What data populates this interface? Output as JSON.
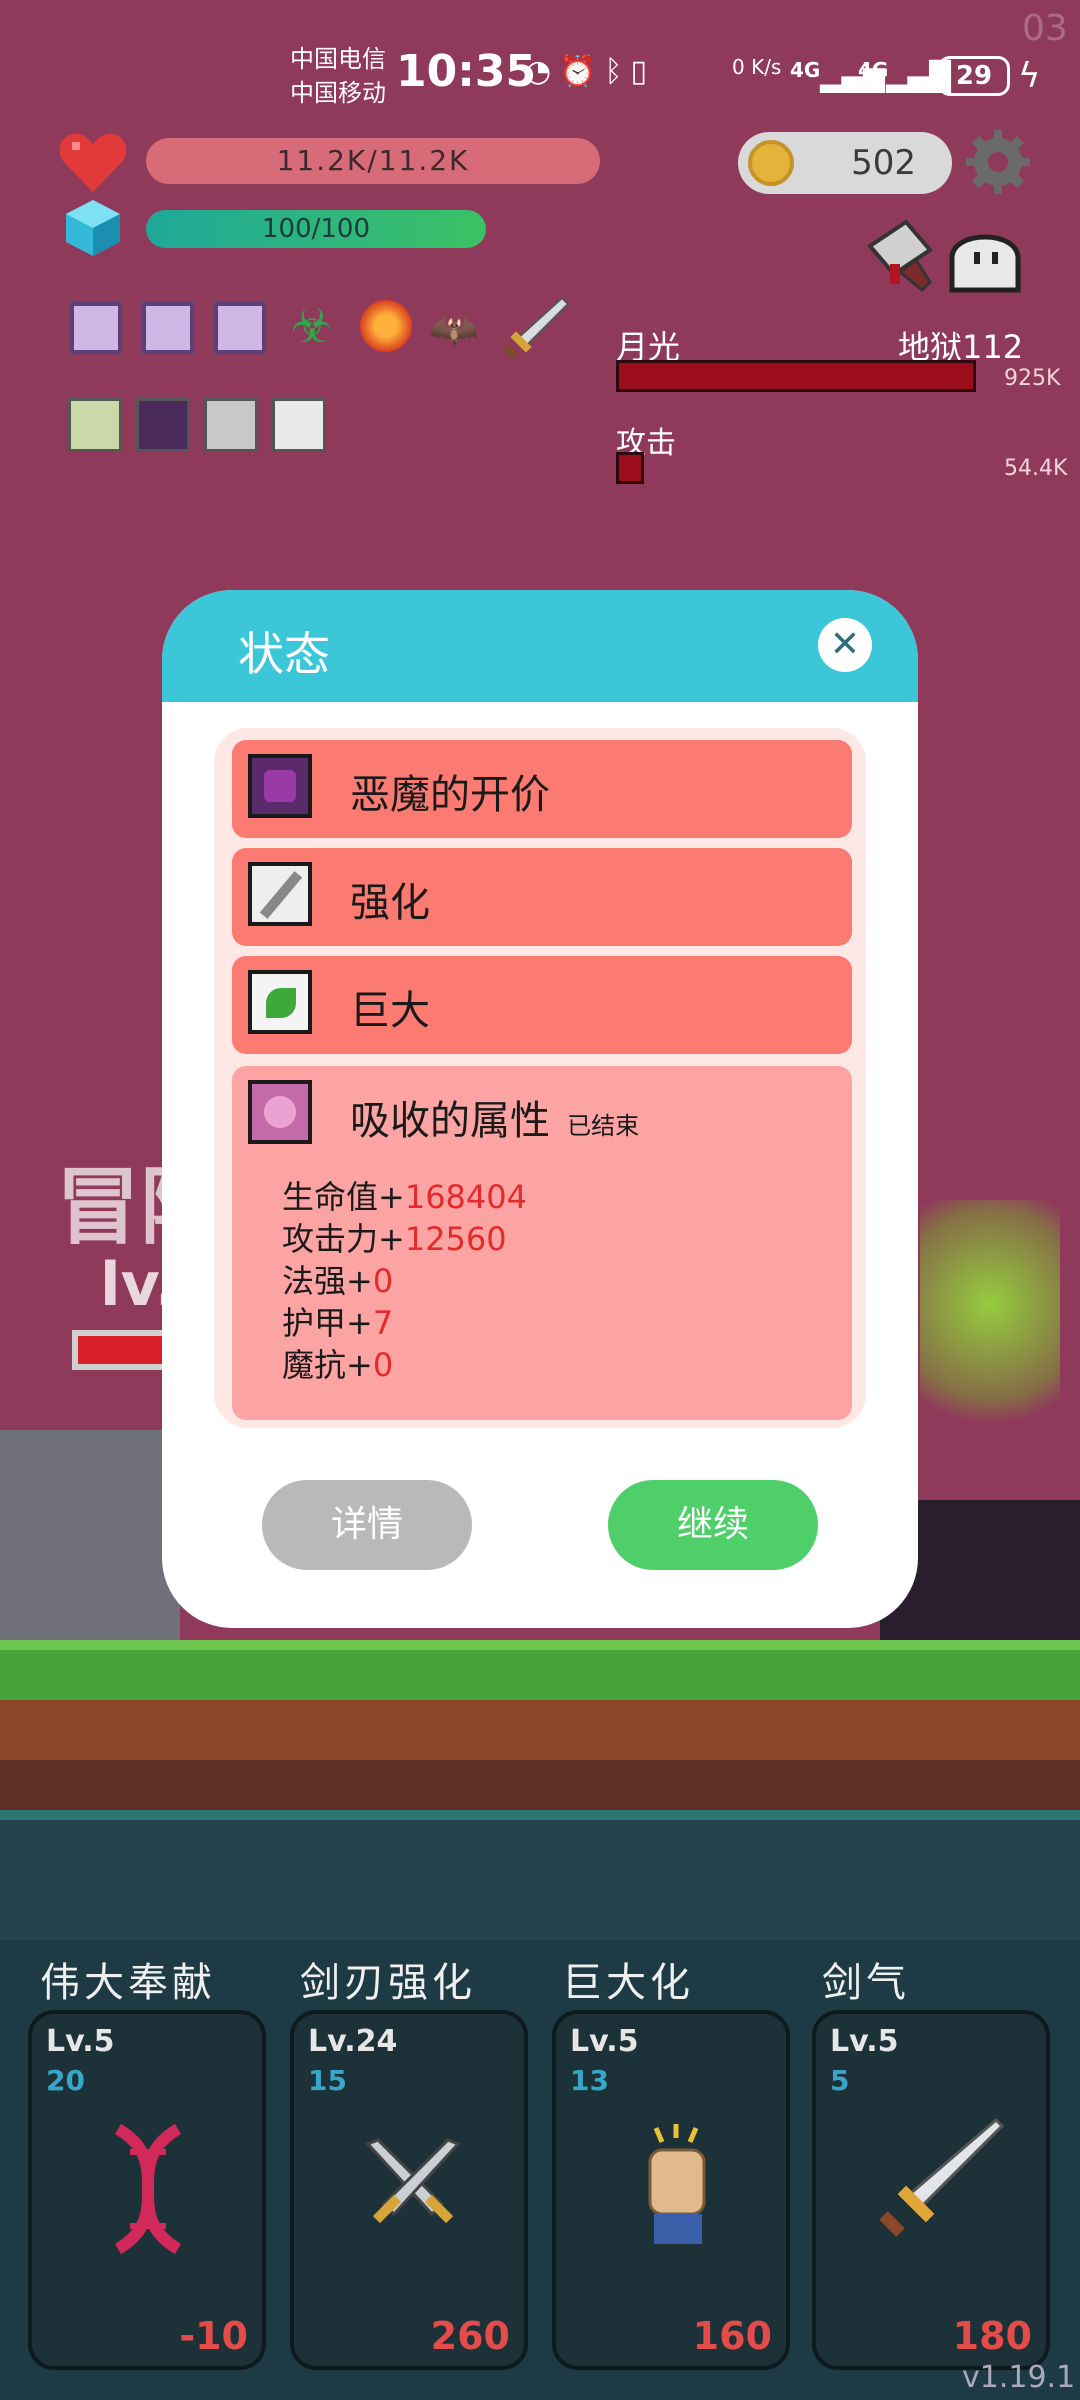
{
  "status_bar": {
    "carrier_1": "中国电信",
    "carrier_2": "中国移动",
    "time": "10:35",
    "net_speed": "0 K/s",
    "net_type_1": "4G",
    "net_type_2": "4G",
    "battery": "29",
    "corner_number": "03"
  },
  "hud": {
    "hp_text": "11.2K/11.2K",
    "mp_text": "100/100",
    "coins": "502"
  },
  "enemy": {
    "name": "月光",
    "level": "地狱112",
    "hp_value": "925K",
    "attack_label": "攻击",
    "attack_value": "54.4K"
  },
  "background": {
    "partial_title": "冒险",
    "partial_level": "lv."
  },
  "modal": {
    "title": "状态",
    "close_icon": "close-icon",
    "items": [
      {
        "label": "恶魔的开价",
        "icon": "demon-icon"
      },
      {
        "label": "强化",
        "icon": "blade-icon"
      },
      {
        "label": "巨大",
        "icon": "sprout-icon"
      }
    ],
    "absorb": {
      "label": "吸收的属性",
      "status": "已结束",
      "stats": [
        {
          "name": "生命值+",
          "value": "168404"
        },
        {
          "name": "攻击力+",
          "value": "12560"
        },
        {
          "name": "法强+",
          "value": "0"
        },
        {
          "name": "护甲+",
          "value": "7"
        },
        {
          "name": "魔抗+",
          "value": "0"
        }
      ]
    },
    "detail_button": "详情",
    "continue_button": "继续"
  },
  "skills": [
    {
      "title": "伟大奉献",
      "level": "Lv.5",
      "sub": "20",
      "cost": "-10",
      "icon": "dna-icon"
    },
    {
      "title": "剑刃强化",
      "level": "Lv.24",
      "sub": "15",
      "cost": "260",
      "icon": "crossed-swords-icon"
    },
    {
      "title": "巨大化",
      "level": "Lv.5",
      "sub": "13",
      "cost": "160",
      "icon": "fist-icon"
    },
    {
      "title": "剑气",
      "level": "Lv.5",
      "sub": "5",
      "cost": "180",
      "icon": "sword-icon"
    }
  ],
  "version": "v1.19.1",
  "colors": {
    "background": "#8f3a5a",
    "modal_header": "#3cc7d9",
    "item_bg": "#fb7a72",
    "continue_button": "#4ecf6a",
    "detail_button": "#b9b9b9"
  }
}
